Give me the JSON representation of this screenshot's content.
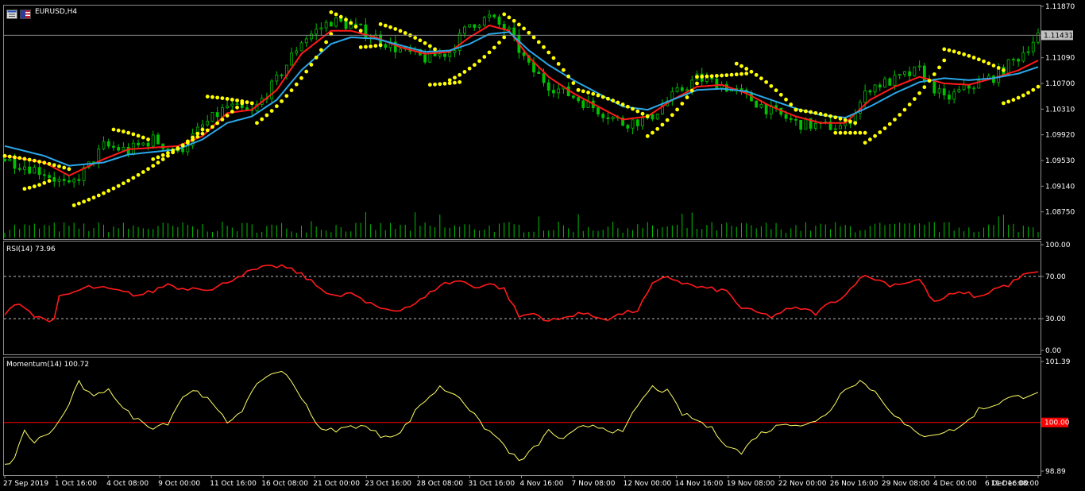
{
  "chart_data": [
    {
      "type": "candlestick",
      "name": "price",
      "title": "EURUSD,H4",
      "ylim": [
        1.0836,
        1.1187
      ],
      "y_ticks": [
        "1.11870",
        "1.11090",
        "1.10700",
        "1.10310",
        "1.09920",
        "1.09530",
        "1.09140",
        "1.08750"
      ],
      "current_price_label": "1.11431",
      "current_price": 1.11431,
      "x_tick_labels": [
        "27 Sep 2019",
        "1 Oct 16:00",
        "4 Oct 08:00",
        "9 Oct 00:00",
        "11 Oct 16:00",
        "16 Oct 08:00",
        "21 Oct 00:00",
        "23 Oct 16:00",
        "28 Oct 08:00",
        "31 Oct 16:00",
        "4 Nov 16:00",
        "7 Nov 08:00",
        "12 Nov 00:00",
        "14 Nov 16:00",
        "19 Nov 08:00",
        "22 Nov 00:00",
        "26 Nov 16:00",
        "29 Nov 08:00",
        "4 Dec 00:00",
        "6 Dec 16:00",
        "11 Dec 08:00"
      ],
      "close_path": [
        [
          0,
          1.0955
        ],
        [
          8,
          1.0935
        ],
        [
          13,
          1.0912
        ],
        [
          17,
          1.0945
        ],
        [
          20,
          1.0975
        ],
        [
          25,
          1.0968
        ],
        [
          30,
          1.0985
        ],
        [
          35,
          1.0965
        ],
        [
          40,
          1.1005
        ],
        [
          45,
          1.1035
        ],
        [
          50,
          1.1025
        ],
        [
          55,
          1.1075
        ],
        [
          60,
          1.1135
        ],
        [
          66,
          1.1165
        ],
        [
          70,
          1.1158
        ],
        [
          75,
          1.114
        ],
        [
          80,
          1.112
        ],
        [
          85,
          1.1108
        ],
        [
          90,
          1.1118
        ],
        [
          94,
          1.116
        ],
        [
          98,
          1.117
        ],
        [
          102,
          1.1148
        ],
        [
          106,
          1.1095
        ],
        [
          110,
          1.1068
        ],
        [
          115,
          1.105
        ],
        [
          120,
          1.103
        ],
        [
          125,
          1.101
        ],
        [
          130,
          1.1015
        ],
        [
          135,
          1.105
        ],
        [
          140,
          1.1078
        ],
        [
          145,
          1.1068
        ],
        [
          150,
          1.105
        ],
        [
          155,
          1.1028
        ],
        [
          160,
          1.101
        ],
        [
          165,
          1.1005
        ],
        [
          170,
          1.1005
        ],
        [
          175,
          1.1065
        ],
        [
          180,
          1.1075
        ],
        [
          185,
          1.109
        ],
        [
          190,
          1.1045
        ],
        [
          195,
          1.1065
        ],
        [
          200,
          1.108
        ],
        [
          205,
          1.111
        ],
        [
          209,
          1.1143
        ]
      ],
      "series": [
        {
          "name": "MA fast",
          "color": "#ff1a1a",
          "values": [
            [
              0,
              1.096
            ],
            [
              8,
              1.095
            ],
            [
              13,
              1.093
            ],
            [
              20,
              1.0955
            ],
            [
              25,
              1.097
            ],
            [
              35,
              1.0975
            ],
            [
              40,
              1.099
            ],
            [
              45,
              1.1025
            ],
            [
              50,
              1.103
            ],
            [
              55,
              1.106
            ],
            [
              60,
              1.1115
            ],
            [
              66,
              1.115
            ],
            [
              70,
              1.115
            ],
            [
              75,
              1.114
            ],
            [
              80,
              1.1125
            ],
            [
              85,
              1.1115
            ],
            [
              90,
              1.1118
            ],
            [
              94,
              1.114
            ],
            [
              98,
              1.1158
            ],
            [
              102,
              1.115
            ],
            [
              106,
              1.111
            ],
            [
              110,
              1.108
            ],
            [
              115,
              1.1055
            ],
            [
              120,
              1.1035
            ],
            [
              125,
              1.1015
            ],
            [
              130,
              1.102
            ],
            [
              135,
              1.1045
            ],
            [
              140,
              1.1065
            ],
            [
              145,
              1.1068
            ],
            [
              150,
              1.1055
            ],
            [
              155,
              1.1035
            ],
            [
              160,
              1.102
            ],
            [
              165,
              1.101
            ],
            [
              170,
              1.101
            ],
            [
              175,
              1.1045
            ],
            [
              180,
              1.1065
            ],
            [
              185,
              1.108
            ],
            [
              190,
              1.107
            ],
            [
              195,
              1.1068
            ],
            [
              200,
              1.1078
            ],
            [
              205,
              1.109
            ],
            [
              209,
              1.1105
            ]
          ]
        },
        {
          "name": "MA slow",
          "color": "#2aa7e8",
          "values": [
            [
              0,
              1.0975
            ],
            [
              8,
              1.096
            ],
            [
              13,
              1.0945
            ],
            [
              20,
              1.095
            ],
            [
              25,
              1.0962
            ],
            [
              35,
              1.097
            ],
            [
              40,
              1.0985
            ],
            [
              45,
              1.101
            ],
            [
              50,
              1.102
            ],
            [
              55,
              1.1045
            ],
            [
              60,
              1.109
            ],
            [
              66,
              1.113
            ],
            [
              70,
              1.114
            ],
            [
              75,
              1.1138
            ],
            [
              80,
              1.1128
            ],
            [
              85,
              1.1118
            ],
            [
              90,
              1.112
            ],
            [
              94,
              1.113
            ],
            [
              98,
              1.1145
            ],
            [
              102,
              1.1148
            ],
            [
              106,
              1.112
            ],
            [
              110,
              1.1098
            ],
            [
              115,
              1.1075
            ],
            [
              120,
              1.1055
            ],
            [
              125,
              1.1035
            ],
            [
              130,
              1.103
            ],
            [
              135,
              1.1045
            ],
            [
              140,
              1.106
            ],
            [
              145,
              1.1062
            ],
            [
              150,
              1.1058
            ],
            [
              155,
              1.1045
            ],
            [
              160,
              1.1032
            ],
            [
              165,
              1.1022
            ],
            [
              170,
              1.1018
            ],
            [
              175,
              1.1035
            ],
            [
              180,
              1.1055
            ],
            [
              185,
              1.1072
            ],
            [
              190,
              1.1078
            ],
            [
              195,
              1.1075
            ],
            [
              200,
              1.1078
            ],
            [
              205,
              1.1085
            ],
            [
              209,
              1.1095
            ]
          ]
        }
      ],
      "sar": {
        "color": "#ffff00",
        "segments": [
          {
            "start": 0,
            "end": 13,
            "v0": 1.096,
            "v1": 1.094
          },
          {
            "start": 4,
            "end": 9,
            "v0": 1.091,
            "v1": 1.0922
          },
          {
            "start": 14,
            "end": 40,
            "v0": 1.0885,
            "v1": 1.1
          },
          {
            "start": 22,
            "end": 29,
            "v0": 1.1,
            "v1": 1.0985
          },
          {
            "start": 30,
            "end": 48,
            "v0": 1.0955,
            "v1": 1.104
          },
          {
            "start": 41,
            "end": 50,
            "v0": 1.105,
            "v1": 1.104
          },
          {
            "start": 51,
            "end": 66,
            "v0": 1.101,
            "v1": 1.1145
          },
          {
            "start": 66,
            "end": 72,
            "v0": 1.1178,
            "v1": 1.115
          },
          {
            "start": 72,
            "end": 76,
            "v0": 1.1125,
            "v1": 1.1128
          },
          {
            "start": 76,
            "end": 87,
            "v0": 1.116,
            "v1": 1.1122
          },
          {
            "start": 86,
            "end": 92,
            "v0": 1.1068,
            "v1": 1.1072
          },
          {
            "start": 90,
            "end": 101,
            "v0": 1.1075,
            "v1": 1.114
          },
          {
            "start": 101,
            "end": 116,
            "v0": 1.1175,
            "v1": 1.106
          },
          {
            "start": 116,
            "end": 130,
            "v0": 1.106,
            "v1": 1.102
          },
          {
            "start": 130,
            "end": 140,
            "v0": 1.099,
            "v1": 1.107
          },
          {
            "start": 140,
            "end": 150,
            "v0": 1.108,
            "v1": 1.1085
          },
          {
            "start": 148,
            "end": 160,
            "v0": 1.11,
            "v1": 1.103
          },
          {
            "start": 160,
            "end": 172,
            "v0": 1.103,
            "v1": 1.101
          },
          {
            "start": 168,
            "end": 174,
            "v0": 1.0995,
            "v1": 1.0995
          },
          {
            "start": 174,
            "end": 190,
            "v0": 1.098,
            "v1": 1.1105
          },
          {
            "start": 190,
            "end": 202,
            "v0": 1.1122,
            "v1": 1.109
          },
          {
            "start": 202,
            "end": 209,
            "v0": 1.104,
            "v1": 1.1065
          }
        ]
      }
    },
    {
      "type": "line",
      "name": "RSI",
      "title": "RSI(14) 73.96",
      "ylim": [
        0,
        100
      ],
      "y_ticks": [
        "100.00",
        "70.00",
        "30.00",
        "0.00"
      ],
      "levels": [
        70,
        30
      ],
      "color": "#ff1a1a",
      "values": [
        [
          0,
          32
        ],
        [
          2,
          45
        ],
        [
          4,
          42
        ],
        [
          6,
          32
        ],
        [
          8,
          30
        ],
        [
          10,
          28
        ],
        [
          11,
          50
        ],
        [
          14,
          55
        ],
        [
          17,
          60
        ],
        [
          21,
          58
        ],
        [
          24,
          55
        ],
        [
          27,
          52
        ],
        [
          30,
          56
        ],
        [
          33,
          63
        ],
        [
          36,
          58
        ],
        [
          39,
          60
        ],
        [
          42,
          57
        ],
        [
          45,
          65
        ],
        [
          48,
          72
        ],
        [
          52,
          78
        ],
        [
          56,
          80
        ],
        [
          60,
          72
        ],
        [
          64,
          58
        ],
        [
          68,
          50
        ],
        [
          70,
          55
        ],
        [
          73,
          45
        ],
        [
          76,
          40
        ],
        [
          79,
          38
        ],
        [
          82,
          42
        ],
        [
          85,
          50
        ],
        [
          88,
          62
        ],
        [
          92,
          66
        ],
        [
          95,
          60
        ],
        [
          98,
          63
        ],
        [
          101,
          58
        ],
        [
          104,
          32
        ],
        [
          107,
          35
        ],
        [
          110,
          28
        ],
        [
          113,
          30
        ],
        [
          116,
          36
        ],
        [
          119,
          32
        ],
        [
          122,
          30
        ],
        [
          125,
          35
        ],
        [
          128,
          38
        ],
        [
          131,
          62
        ],
        [
          134,
          70
        ],
        [
          137,
          64
        ],
        [
          140,
          60
        ],
        [
          143,
          58
        ],
        [
          146,
          56
        ],
        [
          149,
          40
        ],
        [
          152,
          36
        ],
        [
          155,
          32
        ],
        [
          158,
          38
        ],
        [
          161,
          40
        ],
        [
          164,
          35
        ],
        [
          167,
          45
        ],
        [
          170,
          52
        ],
        [
          173,
          70
        ],
        [
          176,
          68
        ],
        [
          179,
          62
        ],
        [
          182,
          64
        ],
        [
          185,
          67
        ],
        [
          188,
          45
        ],
        [
          191,
          52
        ],
        [
          194,
          55
        ],
        [
          197,
          50
        ],
        [
          200,
          58
        ],
        [
          203,
          62
        ],
        [
          206,
          71
        ],
        [
          209,
          74
        ]
      ]
    },
    {
      "type": "line",
      "name": "Momentum",
      "title": "Momentum(14) 100.72",
      "ylim": [
        98.89,
        101.39
      ],
      "y_ticks": [
        "101.39",
        "100.00",
        "98.89"
      ],
      "level": 100.0,
      "level_label": "100.00",
      "color": "#ffff66",
      "values": [
        [
          0,
          99.0
        ],
        [
          2,
          99.2
        ],
        [
          4,
          99.8
        ],
        [
          6,
          99.55
        ],
        [
          8,
          99.7
        ],
        [
          10,
          99.85
        ],
        [
          12,
          100.2
        ],
        [
          15,
          100.9
        ],
        [
          18,
          100.55
        ],
        [
          21,
          100.8
        ],
        [
          24,
          100.3
        ],
        [
          27,
          100.05
        ],
        [
          30,
          99.9
        ],
        [
          33,
          100.0
        ],
        [
          36,
          100.6
        ],
        [
          39,
          100.75
        ],
        [
          42,
          100.4
        ],
        [
          45,
          100.0
        ],
        [
          48,
          100.3
        ],
        [
          52,
          101.0
        ],
        [
          56,
          101.2
        ],
        [
          60,
          100.6
        ],
        [
          64,
          99.8
        ],
        [
          68,
          99.85
        ],
        [
          72,
          99.95
        ],
        [
          76,
          99.7
        ],
        [
          80,
          99.75
        ],
        [
          84,
          100.4
        ],
        [
          88,
          100.8
        ],
        [
          92,
          100.6
        ],
        [
          96,
          100.0
        ],
        [
          100,
          99.6
        ],
        [
          104,
          99.1
        ],
        [
          107,
          99.4
        ],
        [
          110,
          99.8
        ],
        [
          113,
          99.6
        ],
        [
          116,
          99.85
        ],
        [
          119,
          99.95
        ],
        [
          122,
          99.85
        ],
        [
          125,
          99.75
        ],
        [
          128,
          100.4
        ],
        [
          131,
          100.8
        ],
        [
          134,
          100.7
        ],
        [
          137,
          100.2
        ],
        [
          140,
          100.05
        ],
        [
          143,
          99.85
        ],
        [
          146,
          99.5
        ],
        [
          149,
          99.3
        ],
        [
          152,
          99.7
        ],
        [
          155,
          99.85
        ],
        [
          158,
          100.0
        ],
        [
          161,
          99.95
        ],
        [
          164,
          100.0
        ],
        [
          167,
          100.3
        ],
        [
          170,
          100.8
        ],
        [
          173,
          100.95
        ],
        [
          176,
          100.7
        ],
        [
          179,
          100.3
        ],
        [
          182,
          99.95
        ],
        [
          185,
          99.7
        ],
        [
          188,
          99.75
        ],
        [
          191,
          99.8
        ],
        [
          194,
          99.95
        ],
        [
          197,
          100.3
        ],
        [
          200,
          100.4
        ],
        [
          203,
          100.55
        ],
        [
          206,
          100.6
        ],
        [
          209,
          100.72
        ]
      ]
    }
  ],
  "colors": {
    "background": "#000000",
    "grid": "#8c8c8c",
    "candle": "#00c000",
    "volume": "#00c000",
    "bid_line": "#8c8c8c",
    "label_bg": "#c0c0c0",
    "momentum_level_bg": "#ff0000"
  },
  "icons": [
    "chart-window-icon",
    "flag-icon"
  ]
}
